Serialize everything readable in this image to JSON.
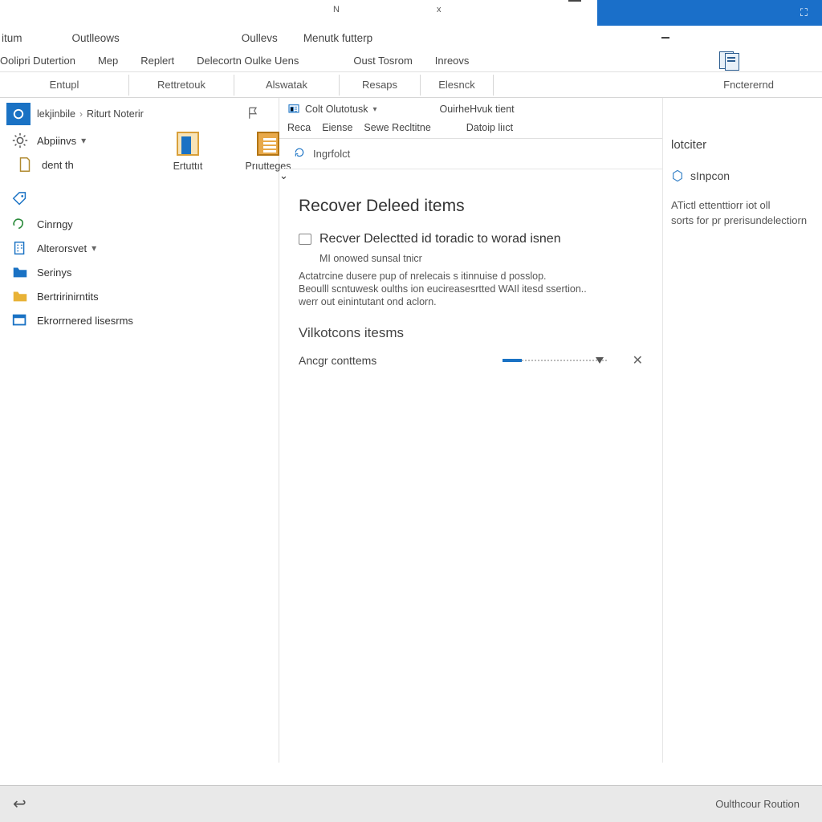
{
  "titlebar": {
    "mark_left": "N",
    "mark_x": "x"
  },
  "menu1": {
    "items": [
      "itum",
      "Outlleows",
      "Oullevs",
      "Menutk futterp"
    ]
  },
  "ribbon_tabs": {
    "items": [
      "Oolipri Dutertion",
      "Mep",
      "Replert",
      "Delecortn Oulke Uens",
      "Oust Tosrom",
      "Inreovs"
    ]
  },
  "ribbon_groups": {
    "items": [
      "Entupl",
      "Rettretouk",
      "Alswatak",
      "Resaps",
      "Elesnck"
    ],
    "right": "Fncterernd"
  },
  "breadcrumb": {
    "a": "lekjinbile",
    "b": "Riturt Noterir"
  },
  "sidebar": {
    "items": [
      {
        "label": "Abpiinvs",
        "has_caret": true
      },
      {
        "label": "dent th"
      }
    ],
    "items2": [
      {
        "label": "Cinrngy"
      },
      {
        "label": "Alterorsvet",
        "has_caret": true
      },
      {
        "label": "Serinys"
      },
      {
        "label": "Bertririnirntits"
      },
      {
        "label": "Ekrorrnered lisesrms"
      }
    ]
  },
  "big_icons": {
    "a": "Ertuttıt",
    "b": "Prıutteges"
  },
  "center_toolbar": {
    "left": "Colt Olutotusk",
    "right": "OuirheHvuk tient"
  },
  "center_toolbar2": {
    "items": [
      "Reca",
      "Eiense",
      "Sewe Recltitne",
      "Datoip liıct"
    ]
  },
  "info": "Ingrfolct",
  "content": {
    "heading": "Recover Deleed items",
    "row_title": "Recver Delectted id toradic to worad isnen",
    "sub": "MI onowed sunsal tnicr",
    "desc1": "Actatrcine dusere pup of nrelecais s itinnuise d posslop.",
    "desc2": "Beoulll scntuwesk oulths ion eucireasesrtted WAIl itesd ssertion..",
    "desc3": "werr out einintutant ond aclorn.",
    "h2": "Vilkotcons itesms",
    "field": "Ancgr conttems"
  },
  "rightcol": {
    "title": "lotciter",
    "sub": "sInpcon",
    "body1": "ATictl ettenttiorr iot oll",
    "body2": "sorts for pr prerisundelectiorn"
  },
  "statusbar": {
    "text": "Oulthcour Roution"
  }
}
